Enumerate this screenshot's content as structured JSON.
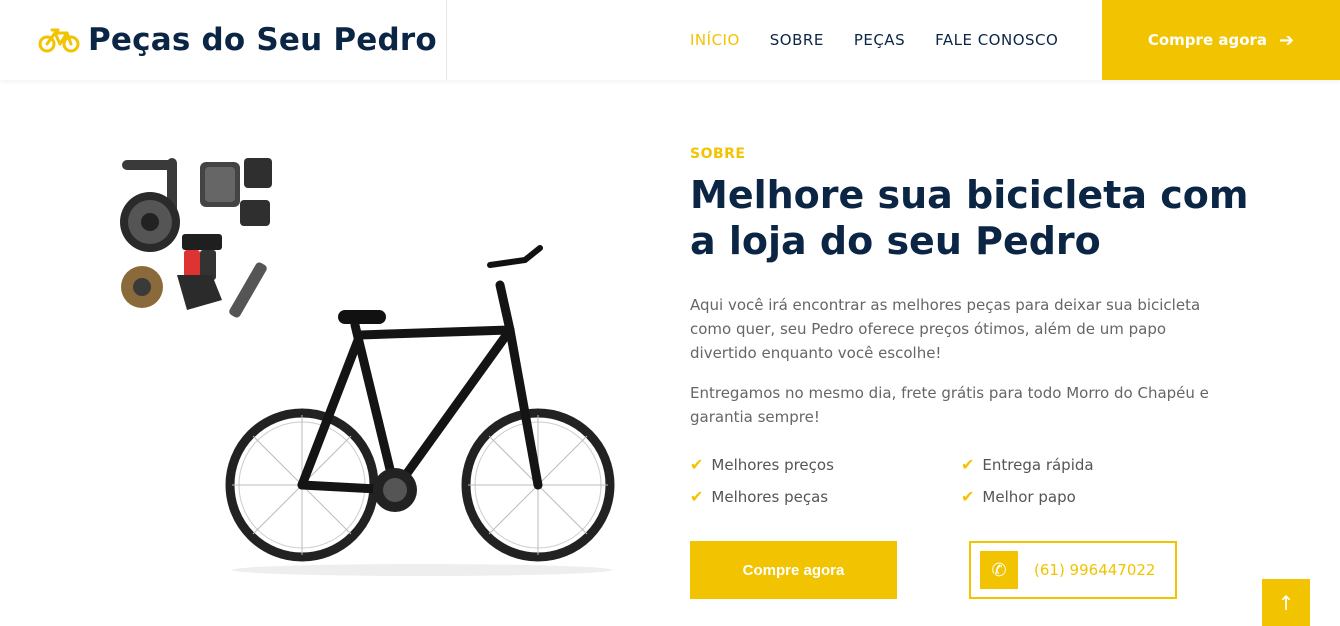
{
  "brand": {
    "title": "Peças do Seu Pedro",
    "icon": "bicycle-icon"
  },
  "nav": {
    "items": [
      {
        "label": "INÍCIO",
        "active": true
      },
      {
        "label": "SOBRE",
        "active": false
      },
      {
        "label": "PEÇAS",
        "active": false
      },
      {
        "label": "FALE CONOSCO",
        "active": false
      }
    ],
    "cta_label": "Compre agora",
    "cta_icon": "arrow-right-icon"
  },
  "about": {
    "eyebrow": "SOBRE",
    "headline": "Melhore sua bicicleta com a loja do seu Pedro",
    "paragraph1": "Aqui você irá encontrar as melhores peças para deixar sua bicicleta como quer, seu Pedro oferece preços ótimos, além de um papo divertido enquanto você escolhe!",
    "paragraph2": "Entregamos no mesmo dia, frete grátis para todo Morro do Chapéu e garantia sempre!",
    "features": [
      "Melhores preços",
      "Entrega rápida",
      "Melhores peças",
      "Melhor papo"
    ],
    "button_label": "Compre agora",
    "phone": "(61) 996447022"
  },
  "colors": {
    "accent": "#f2c300",
    "navy": "#0b2545",
    "text": "#666666"
  }
}
